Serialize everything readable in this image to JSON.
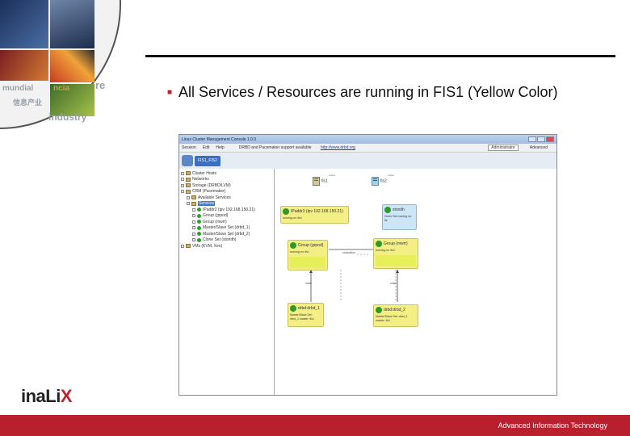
{
  "slide": {
    "bullet_text": "All Services / Resources are running in FIS1 (Yellow Color)",
    "footer_text": "Advanced Information Technology",
    "logo_text_main": "inaLi",
    "logo_text_accent": "X",
    "corner_words": [
      "mundial",
      "ncia",
      "tecnolog",
      "re",
      "industry"
    ],
    "corner_cjk": "信息产业",
    "accent_color": "#b8202e"
  },
  "app": {
    "window_title": "Linux Cluster Management Console 1.0.0",
    "menu": [
      "Session",
      "Edit",
      "Help"
    ],
    "status_text": "DRBD and Pacemaker support available",
    "status_link": "http://www.drbd.org",
    "mode_select": "Administrator",
    "advanced_label": "Advanced",
    "host_tab": "FIS1_FIS2",
    "tree": [
      {
        "label": "Cluster Hosts",
        "kind": "folder",
        "indent": 0
      },
      {
        "label": "Networks",
        "kind": "folder",
        "indent": 0
      },
      {
        "label": "Storage (DRBD/LVM)",
        "kind": "folder",
        "indent": 0
      },
      {
        "label": "CRM (Pacemaker)",
        "kind": "folder",
        "indent": 0
      },
      {
        "label": "Available Services",
        "kind": "folder",
        "indent": 1
      },
      {
        "label": "Services",
        "kind": "folder",
        "indent": 1,
        "selected": true
      },
      {
        "label": "IPaddr2 (ipv 192.168.150.21)",
        "kind": "res",
        "indent": 2
      },
      {
        "label": "Group (grpod)",
        "kind": "res",
        "indent": 2
      },
      {
        "label": "Group (mwrr)",
        "kind": "res",
        "indent": 2
      },
      {
        "label": "Master/Slave Set (drbd_1)",
        "kind": "res",
        "indent": 2
      },
      {
        "label": "Master/Slave Set (drbd_2)",
        "kind": "res",
        "indent": 2
      },
      {
        "label": "Clone Set (stonith)",
        "kind": "res",
        "indent": 2
      },
      {
        "label": "VMs (KVM, Xen)",
        "kind": "folder",
        "indent": 0
      }
    ],
    "hosts": [
      {
        "name": "fis1",
        "tag": "online"
      },
      {
        "name": "fis2",
        "tag": "online"
      }
    ],
    "resources": {
      "ipaddr": {
        "title": "IPaddr2 (ipv 192.168.150.21)",
        "status": "running on: fis1"
      },
      "stonith": {
        "title": "stonith",
        "status": "Clone Set running on: fis"
      },
      "grp_left": {
        "title": "Group (grpod)",
        "status": "running on: fis1"
      },
      "grp_right": {
        "title": "Group (mwrr)",
        "status": "running on: fis1"
      },
      "drbd_left": {
        "title": "drbd:drbd_1",
        "status": "Master/Slave Set: drbd_1 master: fis1"
      },
      "drbd_right": {
        "title": "drbd:drbd_2",
        "status": "Master/Slave Set: drbd_2 master: fis1"
      }
    },
    "edge_labels": {
      "colocation": "colocation",
      "order_left": "order",
      "order_right": "order"
    }
  }
}
